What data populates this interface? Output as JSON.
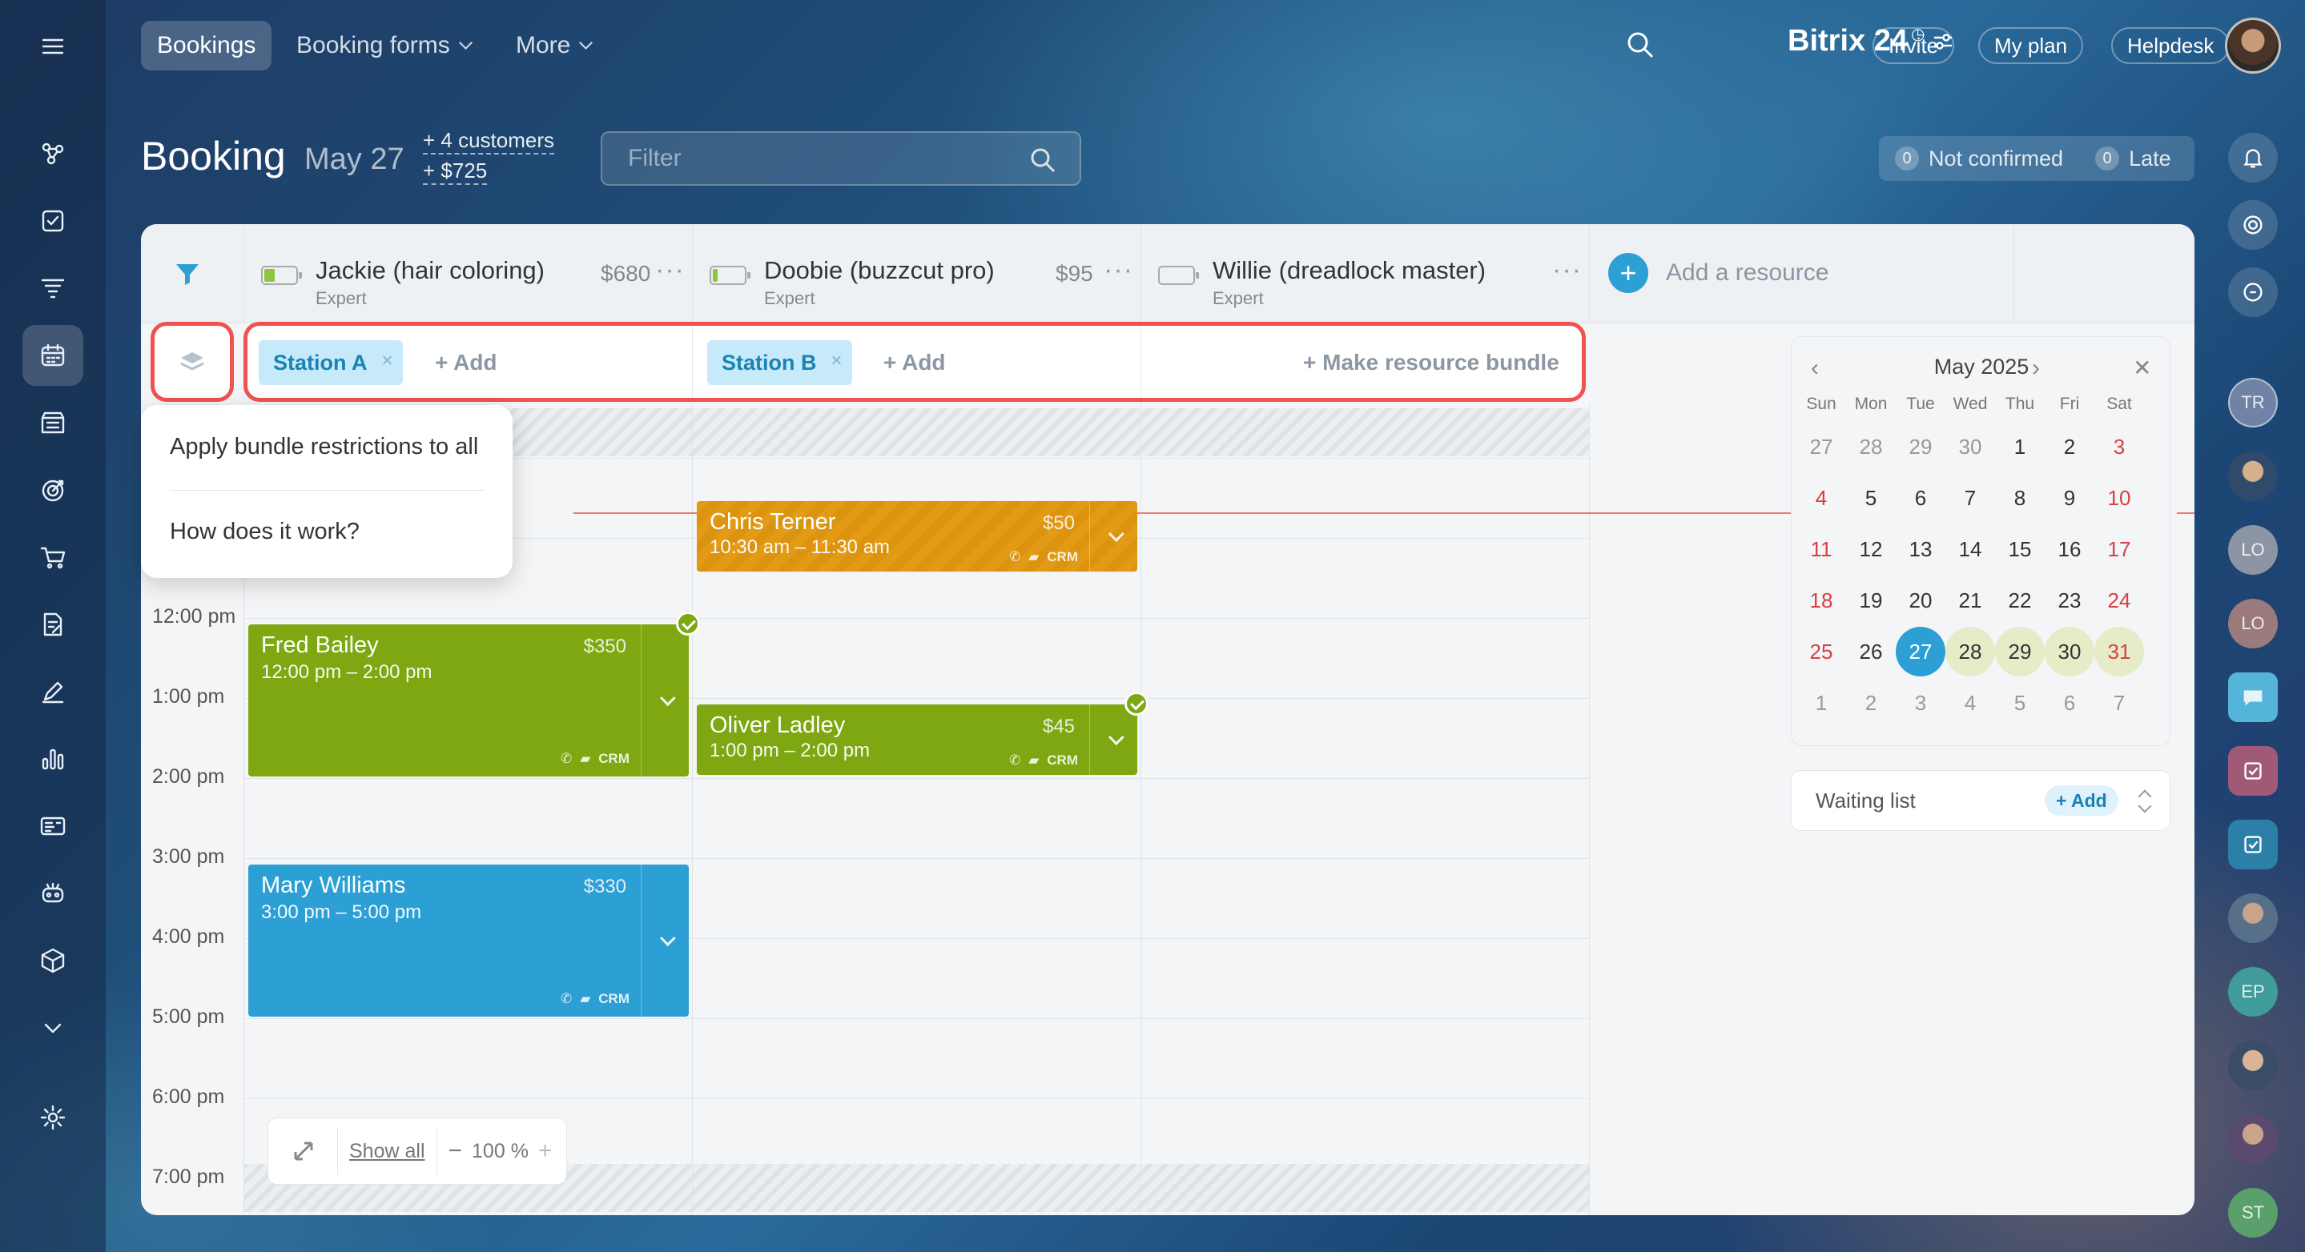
{
  "topbar": {
    "tabs": [
      {
        "label": "Bookings",
        "active": true
      },
      {
        "label": "Booking forms",
        "dropdown": true
      },
      {
        "label": "More",
        "dropdown": true
      }
    ],
    "brand": "Bitrix 24",
    "invite_label": "Invite",
    "myplan_label": "My plan",
    "helpdesk_label": "Helpdesk"
  },
  "header": {
    "title": "Booking",
    "date": "May 27",
    "customers_link": "+ 4 customers",
    "revenue_link": "+ $725",
    "filter_placeholder": "Filter",
    "not_confirmed_count": "0",
    "not_confirmed_label": "Not confirmed",
    "late_count": "0",
    "late_label": "Late"
  },
  "resources": [
    {
      "name": "Jackie (hair coloring)",
      "role": "Expert",
      "price": "$680",
      "battery_fill": 0.35
    },
    {
      "name": "Doobie (buzzcut pro)",
      "role": "Expert",
      "price": "$95",
      "battery_fill": 0.15
    },
    {
      "name": "Willie (dreadlock master)",
      "role": "Expert",
      "price": "",
      "battery_fill": 0
    }
  ],
  "add_resource_label": "Add a resource",
  "bundle": {
    "chips": [
      "Station A",
      "Station B"
    ],
    "add_label": "+ Add",
    "make_bundle_label": "+ Make resource bundle"
  },
  "popup": {
    "item1": "Apply bundle restrictions to all",
    "item2": "How does it work?"
  },
  "time_labels": [
    "12:00 pm",
    "1:00 pm",
    "2:00 pm",
    "3:00 pm",
    "4:00 pm",
    "5:00 pm",
    "6:00 pm",
    "7:00 pm"
  ],
  "events": [
    {
      "name": "Chris Terner",
      "time": "10:30 am – 11:30 am",
      "price": "$50",
      "color": "#e39a14"
    },
    {
      "name": "Fred Bailey",
      "time": "12:00 pm – 2:00 pm",
      "price": "$350",
      "color": "#7ea712"
    },
    {
      "name": "Oliver Ladley",
      "time": "1:00 pm – 2:00 pm",
      "price": "$45",
      "color": "#7ea712"
    },
    {
      "name": "Mary Williams",
      "time": "3:00 pm – 5:00 pm",
      "price": "$330",
      "color": "#2c9fd4"
    }
  ],
  "crm_label": "CRM",
  "zoom": {
    "show_all_label": "Show all",
    "level": "100 %"
  },
  "calendar": {
    "title": "May 2025",
    "days_of_week": [
      "Sun",
      "Mon",
      "Tue",
      "Wed",
      "Thu",
      "Fri",
      "Sat"
    ],
    "weeks": [
      [
        "27",
        "28",
        "29",
        "30",
        "1",
        "2",
        "3"
      ],
      [
        "4",
        "5",
        "6",
        "7",
        "8",
        "9",
        "10"
      ],
      [
        "11",
        "12",
        "13",
        "14",
        "15",
        "16",
        "17"
      ],
      [
        "18",
        "19",
        "20",
        "21",
        "22",
        "23",
        "24"
      ],
      [
        "25",
        "26",
        "27",
        "28",
        "29",
        "30",
        "31"
      ],
      [
        "1",
        "2",
        "3",
        "4",
        "5",
        "6",
        "7"
      ]
    ],
    "selected": "27"
  },
  "waiting_list": {
    "label": "Waiting list",
    "add_label": "+ Add"
  },
  "right_rail_initials": [
    "TR",
    "LO",
    "LO",
    "EP",
    "ST"
  ]
}
